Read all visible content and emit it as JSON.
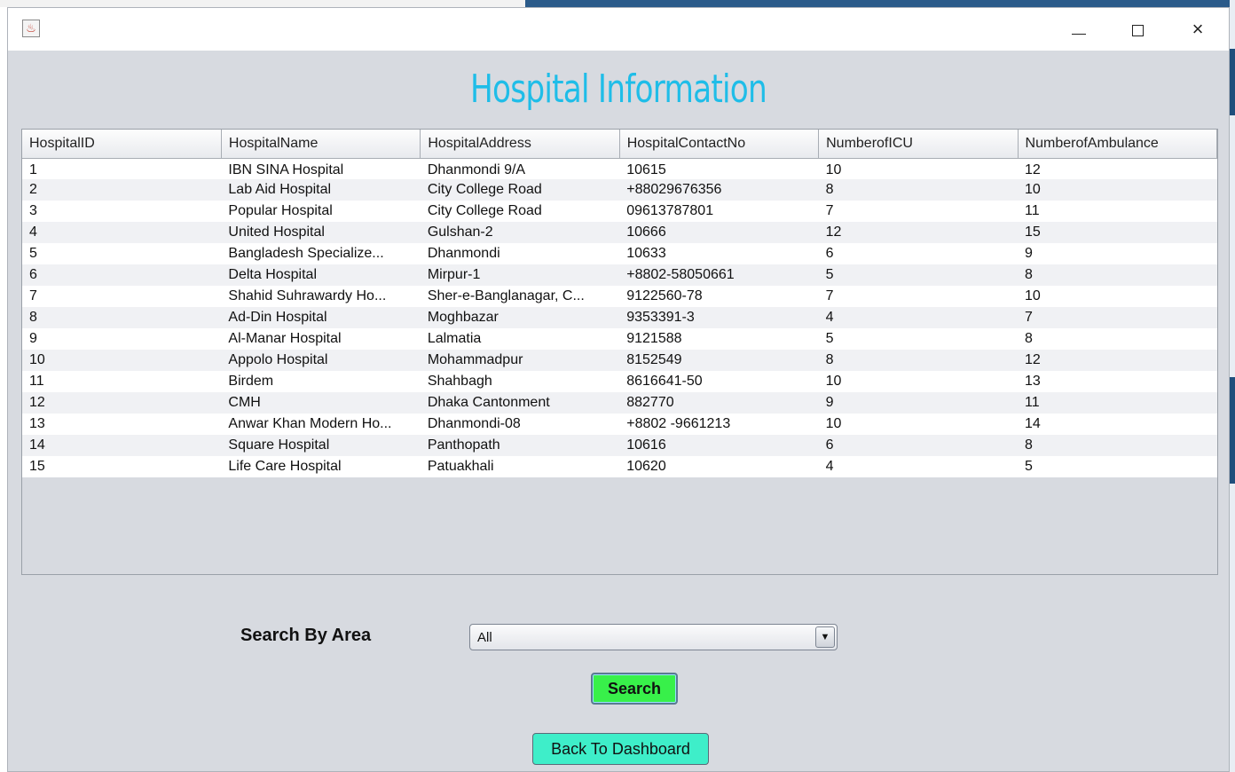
{
  "window": {
    "title": ""
  },
  "page_title": "Hospital Information",
  "table": {
    "columns": [
      "HospitalID",
      "HospitalName",
      "HospitalAddress",
      "HospitalContactNo",
      "NumberofICU",
      "NumberofAmbulance"
    ],
    "rows": [
      [
        "1",
        "IBN SINA Hospital",
        "Dhanmondi 9/A",
        "10615",
        "10",
        "12"
      ],
      [
        "2",
        "Lab Aid Hospital",
        "City College Road",
        "+88029676356",
        "8",
        "10"
      ],
      [
        "3",
        "Popular Hospital",
        "City College Road",
        "09613787801",
        "7",
        "11"
      ],
      [
        "4",
        "United Hospital",
        "Gulshan-2",
        "10666",
        "12",
        "15"
      ],
      [
        "5",
        "Bangladesh Specialize...",
        "Dhanmondi",
        "10633",
        "6",
        "9"
      ],
      [
        "6",
        "Delta Hospital",
        "Mirpur-1",
        "+8802-58050661",
        "5",
        "8"
      ],
      [
        "7",
        "Shahid Suhrawardy Ho...",
        "Sher-e-Banglanagar, C...",
        "9122560-78",
        "7",
        "10"
      ],
      [
        "8",
        "Ad-Din Hospital",
        "Moghbazar",
        "9353391-3",
        "4",
        "7"
      ],
      [
        "9",
        "Al-Manar Hospital",
        "Lalmatia",
        "9121588",
        "5",
        "8"
      ],
      [
        "10",
        "Appolo Hospital",
        "Mohammadpur",
        "8152549",
        "8",
        "12"
      ],
      [
        "11",
        "Birdem",
        "Shahbagh",
        "8616641-50",
        "10",
        "13"
      ],
      [
        "12",
        "CMH",
        "Dhaka Cantonment",
        "882770",
        "9",
        "11"
      ],
      [
        "13",
        "Anwar Khan Modern Ho...",
        "Dhanmondi-08",
        "+8802 -9661213",
        "10",
        "14"
      ],
      [
        "14",
        "Square Hospital",
        "Panthopath",
        "10616",
        "6",
        "8"
      ],
      [
        "15",
        "Life Care Hospital",
        "Patuakhali",
        "10620",
        "4",
        "5"
      ]
    ]
  },
  "search": {
    "label": "Search By Area",
    "selected_area": "All",
    "button_label": "Search"
  },
  "back_button_label": "Back To Dashboard",
  "window_controls": {
    "minimize": "minimize-icon",
    "maximize": "maximize-icon",
    "close": "×"
  },
  "colors": {
    "title": "#1fbde8",
    "search_button": "#38f04a",
    "back_button": "#3eeec9",
    "window_bg": "#d7dae0"
  }
}
